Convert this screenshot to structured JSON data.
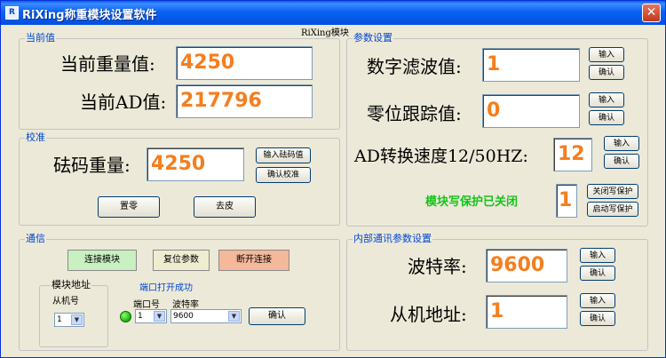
{
  "window": {
    "title": "RiXing称重模块设置软件",
    "close_glyph": "✕",
    "caption": "RiXing模块"
  },
  "current": {
    "group_title": "当前值",
    "weight_label": "当前重量值:",
    "weight_value": "4250",
    "ad_label": "当前AD值:",
    "ad_value": "217796"
  },
  "calib": {
    "group_title": "校准",
    "label": "砝码重量:",
    "value": "4250",
    "input_btn": "输入砝码值",
    "confirm_btn": "确认校准",
    "zero_btn": "置零",
    "tare_btn": "去皮"
  },
  "params": {
    "group_title": "参数设置",
    "filter_label": "数字滤波值:",
    "filter_value": "1",
    "zero_track_label": "零位跟踪值:",
    "zero_track_value": "0",
    "ad_speed_label": "AD转换速度12/50HZ:",
    "ad_speed_value": "12",
    "protect_status": "模块写保护已关闭",
    "protect_value": "1",
    "input_btn": "输入",
    "confirm_btn": "确认",
    "close_protect_btn": "关闭写保护",
    "open_protect_btn": "启动写保护"
  },
  "comm": {
    "group_title": "通信",
    "connect_btn": "连接模块",
    "reset_btn": "复位参数",
    "disconnect_btn": "断开连接",
    "addr_group_title": "模块地址",
    "slave_label": "从机号",
    "slave_value": "1",
    "port_status": "端口打开成功",
    "port_label": "端口号",
    "port_value": "1",
    "baud_label": "波特率",
    "baud_value": "9600",
    "confirm_btn": "确认",
    "arrow_glyph": "▼"
  },
  "internal": {
    "group_title": "内部通讯参数设置",
    "baud_label": "波特率:",
    "baud_value": "9600",
    "slave_label": "从机地址:",
    "slave_value": "1",
    "input_btn": "输入",
    "confirm_btn": "确认"
  },
  "colors": {
    "value_text": "#f57e1e",
    "group_title": "#0046d5",
    "status_green": "#14c41a",
    "connect_bg": "#c8f0c0",
    "reset_bg": "#f0ecd0",
    "disconnect_bg": "#f4b89a"
  }
}
